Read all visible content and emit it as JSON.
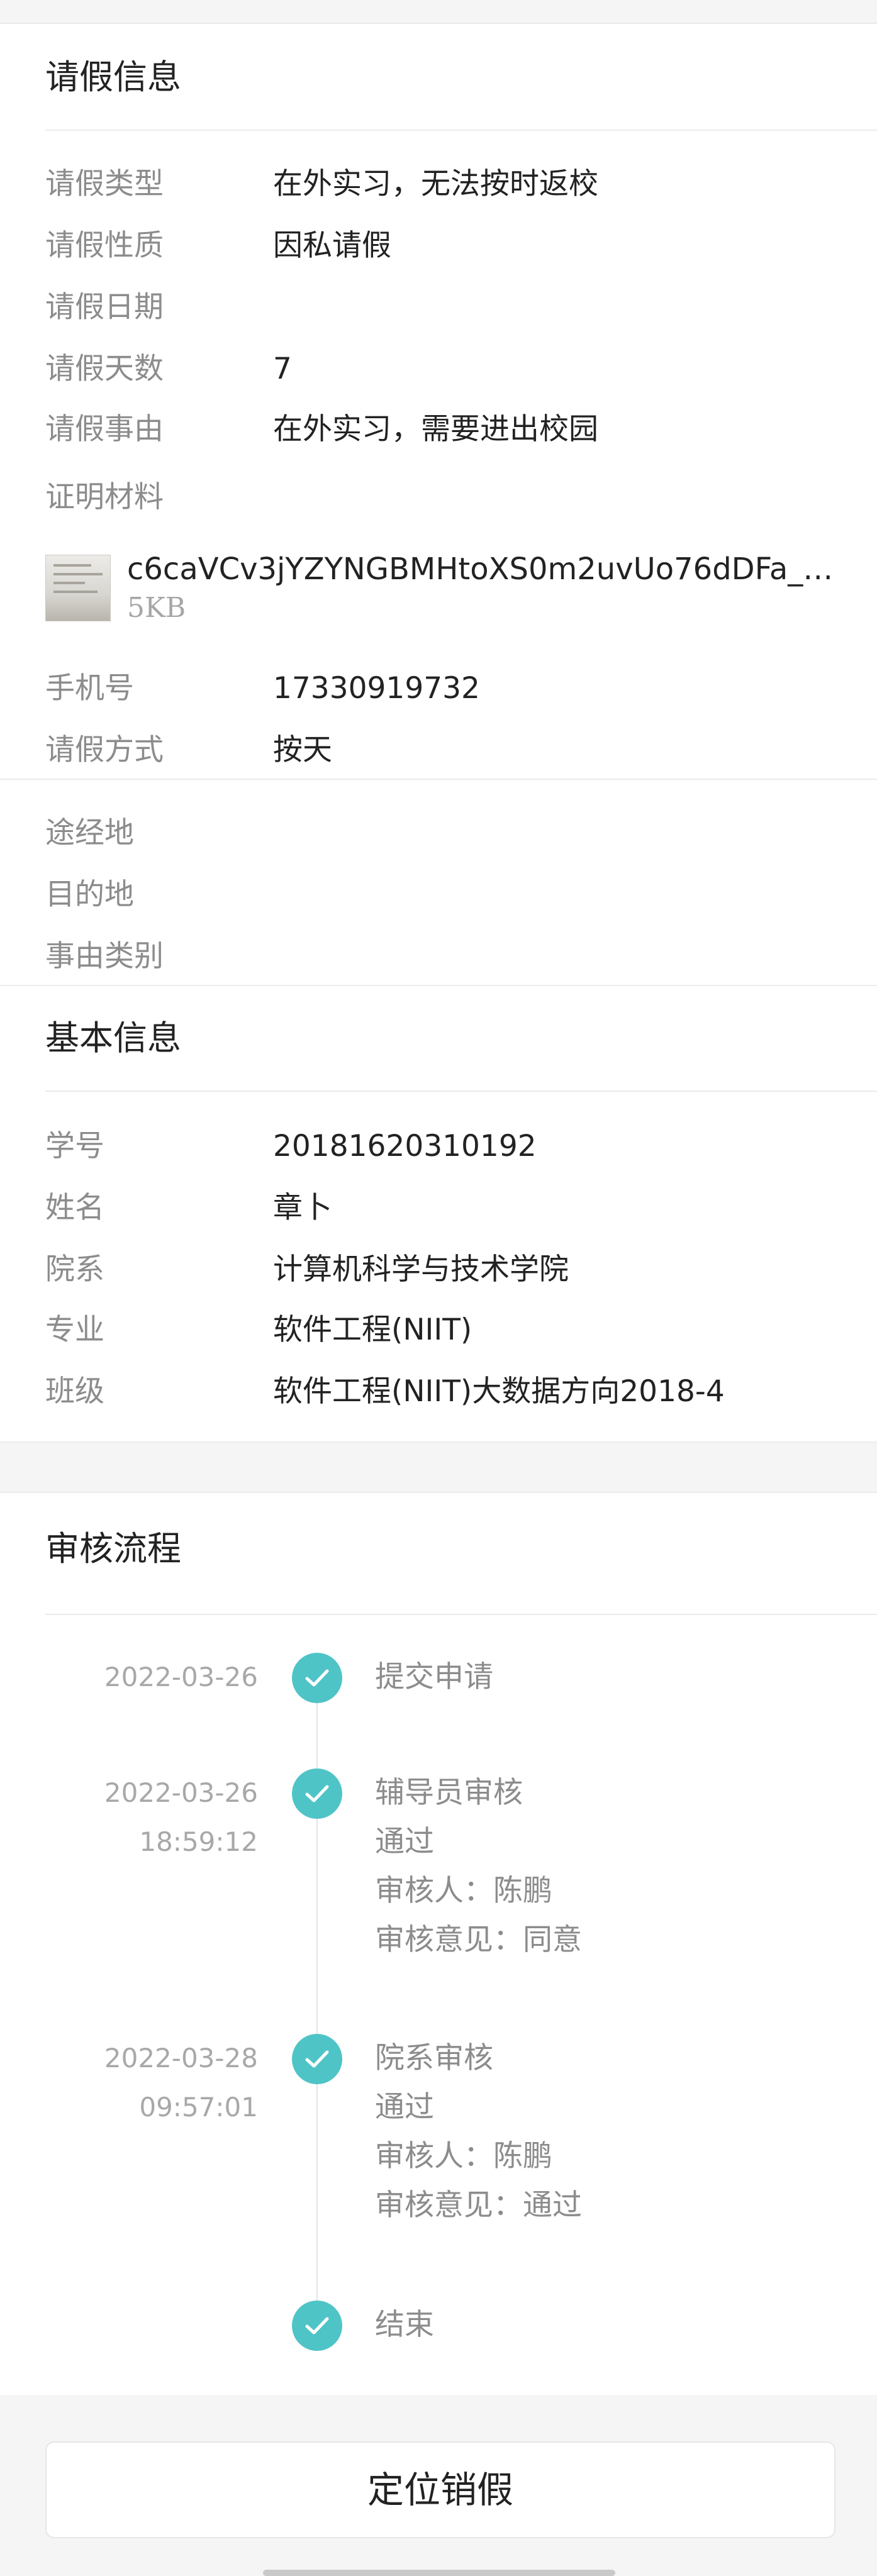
{
  "leave_info": {
    "title": "请假信息",
    "rows": [
      {
        "label": "请假类型",
        "value": "在外实习，无法按时返校"
      },
      {
        "label": "请假性质",
        "value": "因私请假"
      },
      {
        "label": "请假日期",
        "value": ""
      },
      {
        "label": "请假天数",
        "value": "7"
      },
      {
        "label": "请假事由",
        "value": "在外实习，需要进出校园"
      }
    ],
    "proof_label": "证明材料",
    "attachment": {
      "file_name": "c6caVCv3jYZYNGBMHtoXS0m2uvUo76dDFa_A…",
      "file_size": "5KB"
    },
    "rows2": [
      {
        "label": "手机号",
        "value": "17330919732"
      },
      {
        "label": "请假方式",
        "value": "按天"
      }
    ],
    "rows3": [
      {
        "label": "途经地",
        "value": ""
      },
      {
        "label": "目的地",
        "value": ""
      },
      {
        "label": "事由类别",
        "value": ""
      }
    ]
  },
  "basic_info": {
    "title": "基本信息",
    "rows": [
      {
        "label": "学号",
        "value": "20181620310192"
      },
      {
        "label": "姓名",
        "value": "章卜"
      },
      {
        "label": "院系",
        "value": "计算机科学与技术学院"
      },
      {
        "label": "专业",
        "value": "软件工程(NIIT)"
      },
      {
        "label": "班级",
        "value": "软件工程(NIIT)大数据方向2018-4"
      }
    ]
  },
  "review_flow": {
    "title": "审核流程",
    "steps": [
      {
        "date": "2022-03-26",
        "time": "",
        "lines": [
          "提交申请"
        ]
      },
      {
        "date": "2022-03-26",
        "time": "18:59:12",
        "lines": [
          "辅导员审核",
          "通过",
          "审核人：陈鹏",
          "审核意见：同意"
        ]
      },
      {
        "date": "2022-03-28",
        "time": "09:57:01",
        "lines": [
          "院系审核",
          "通过",
          "审核人：陈鹏",
          "审核意见：通过"
        ]
      },
      {
        "date": "",
        "time": "",
        "lines": [
          "结束"
        ]
      }
    ],
    "accent_color": "#4fc4c7"
  },
  "footer": {
    "button_label": "定位销假"
  }
}
